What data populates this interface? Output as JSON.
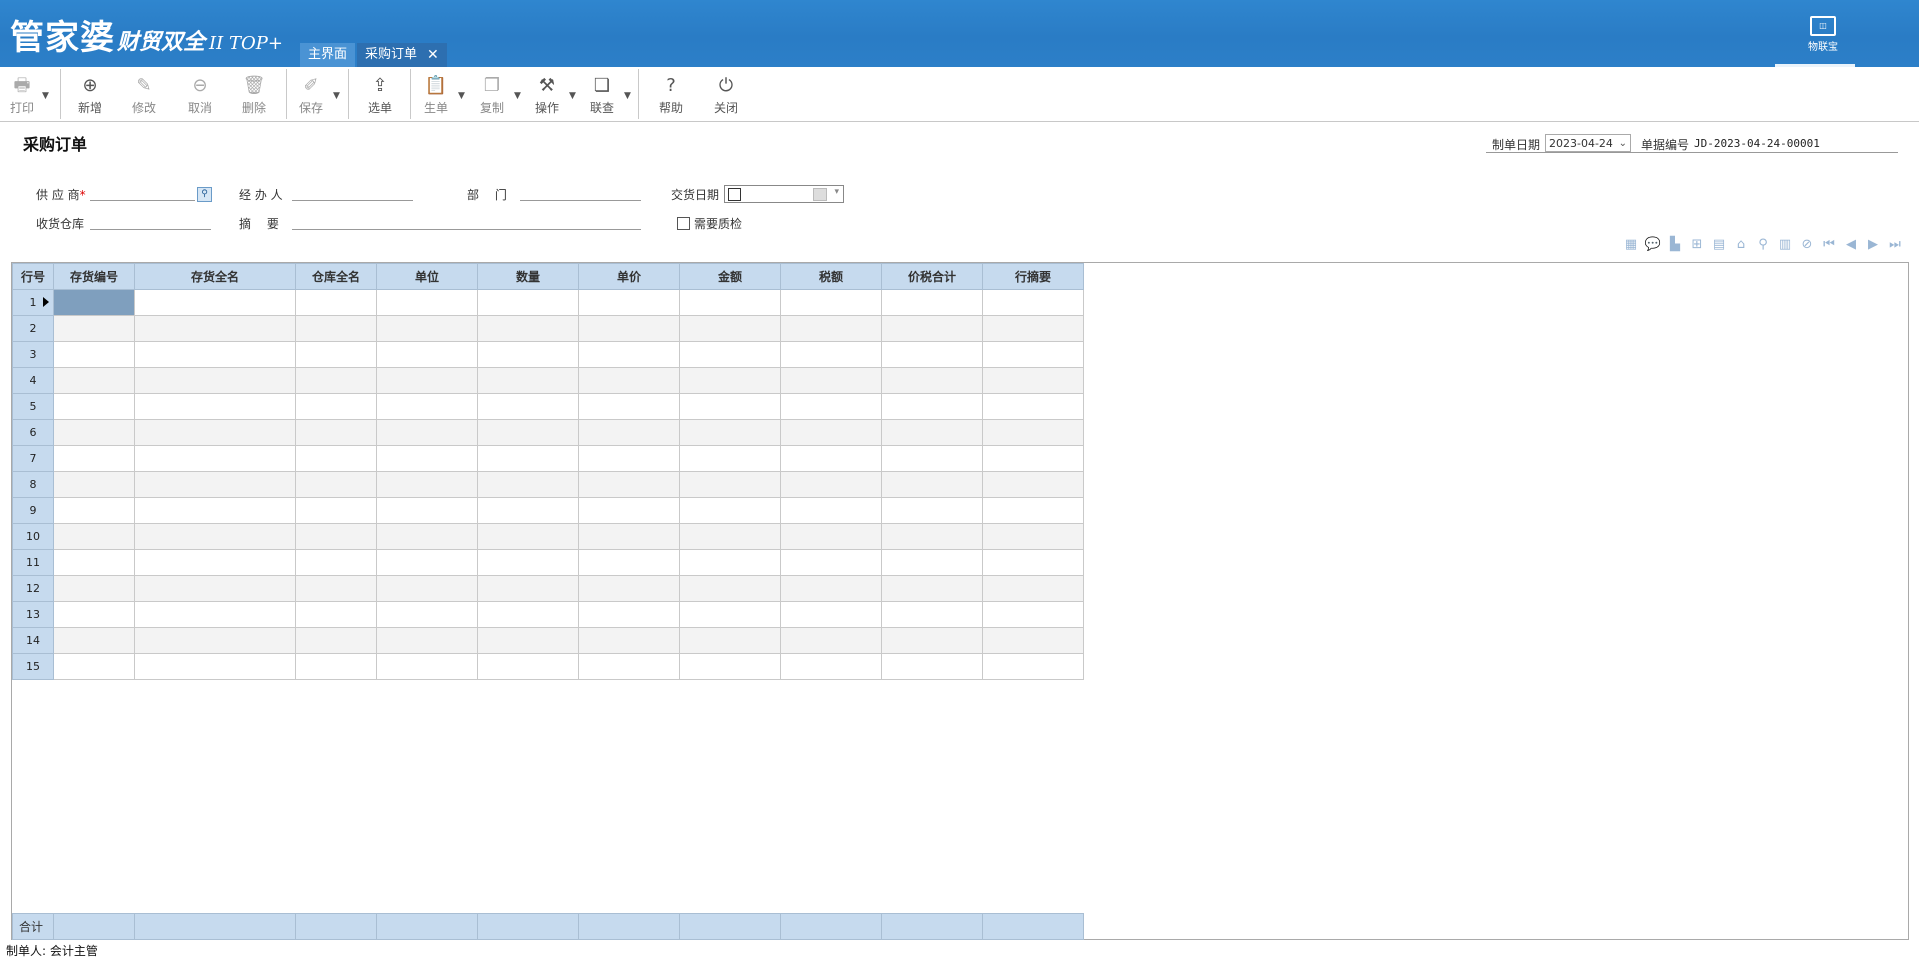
{
  "app": {
    "logo_main": "管家婆",
    "logo_sub": "财贸双全",
    "logo_edition": "II TOP+",
    "iot_label": "物联宝"
  },
  "tabs": [
    {
      "label": "主界面",
      "active": false
    },
    {
      "label": "采购订单",
      "active": true,
      "close": "✕"
    }
  ],
  "toolbar": {
    "print": "打印",
    "add": "新增",
    "edit": "修改",
    "cancel": "取消",
    "delete": "删除",
    "save": "保存",
    "select_order": "选单",
    "generate": "生单",
    "copy": "复制",
    "operate": "操作",
    "link_query": "联查",
    "help": "帮助",
    "close": "关闭"
  },
  "form": {
    "title": "采购订单",
    "date_label": "制单日期",
    "date_value": "2023-04-24",
    "docno_label": "单据编号",
    "docno_value": "JD-2023-04-24-00001",
    "supplier_label": "供 应 商",
    "supplier_required": "*",
    "handler_label": "经 办 人",
    "dept_label": "部　 门",
    "delivery_label": "交货日期",
    "warehouse_label": "收货仓库",
    "summary_label": "摘　 要",
    "qc_label": "需要质检"
  },
  "grid": {
    "columns": [
      "行号",
      "存货编号",
      "存货全名",
      "仓库全名",
      "单位",
      "数量",
      "单价",
      "金额",
      "税额",
      "价税合计",
      "行摘要"
    ],
    "row_numbers": [
      "1",
      "2",
      "3",
      "4",
      "5",
      "6",
      "7",
      "8",
      "9",
      "10",
      "11",
      "12",
      "13",
      "14",
      "15"
    ],
    "total_label": "合计"
  },
  "grid_tools": [
    "grid-layout-icon",
    "comment-icon",
    "building-icon",
    "org-chart-icon",
    "calculator-icon",
    "home-icon",
    "search-icon",
    "table-icon",
    "attachment-icon",
    "first-icon",
    "prev-icon",
    "next-icon",
    "last-icon"
  ],
  "footer": {
    "creator_label": "制单人:",
    "creator_value": "会计主管"
  }
}
